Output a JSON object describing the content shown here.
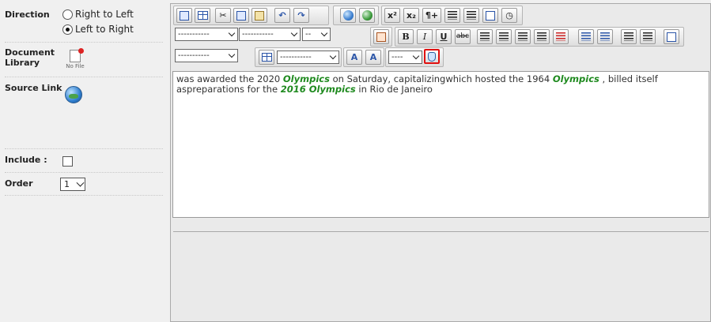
{
  "form": {
    "direction_label": "Direction",
    "direction_options": [
      {
        "label": "Right to Left",
        "selected": false
      },
      {
        "label": "Left to Right",
        "selected": true
      }
    ],
    "document_library_label": "Document Library",
    "no_file_text": "No File",
    "source_link_label": "Source Link",
    "include_label": "Include :",
    "include_checked": false,
    "order_label": "Order",
    "order_value": "1"
  },
  "toolbar": {
    "paragraph_select": "-----------",
    "font_select": "-----------",
    "size_select": "--",
    "style_select": "-----------",
    "table_select": "-----------",
    "class_select": "----",
    "bold": "B",
    "italic": "I",
    "underline": "U",
    "strike": "abc",
    "superscript": "x²",
    "subscript": "x₂",
    "paragraph_mark": "¶+",
    "font_color": "A",
    "bg_color": "A"
  },
  "content": {
    "line1_a": "was awarded the 2020 ",
    "line1_kw1": "Olympics",
    "line1_b": " on Saturday, capitalizingwhich hosted the 1964 ",
    "line1_kw2": "Olympics",
    "line1_c": " , billed itself",
    "line2_a": "aspreparations for the ",
    "line2_kw": "2016 Olympics",
    "line2_b": " in Rio de Janeiro"
  },
  "colors": {
    "keyword": "#1f8a1f",
    "highlight_border": "#e01010"
  }
}
